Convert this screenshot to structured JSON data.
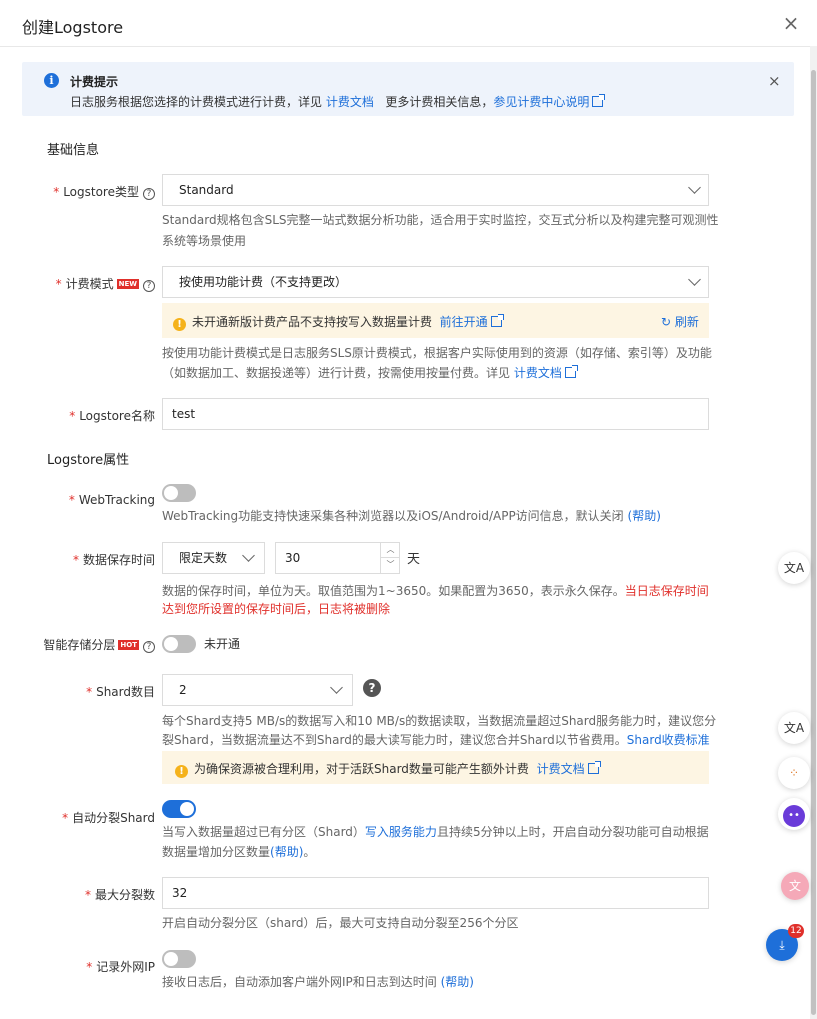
{
  "dialog": {
    "title": "创建Logstore",
    "close_icon": "×"
  },
  "notice": {
    "title": "计费提示",
    "text_prefix": "日志服务根据您选择的计费模式进行计费，详见",
    "link1": "计费文档",
    "text_mid": "更多计费相关信息，",
    "link2": "参见计费中心说明",
    "close_icon": "×"
  },
  "basic": {
    "section": "基础信息",
    "logstore_type": {
      "label": "Logstore类型",
      "value": "Standard",
      "help1": "Standard规格包含SLS完整一站式数据分析功能，适合用于实时监控，交互式分析以及构建完整可观测性",
      "help2": "系统等场景使用"
    },
    "billing_mode": {
      "label": "计费模式",
      "badge": "NEW",
      "value": "按使用功能计费（不支持更改）",
      "warn_text": "未开通新版计费产品不支持按写入数据量计费",
      "warn_link": "前往开通",
      "refresh": "刷新",
      "help1": "按使用功能计费模式是日志服务SLS原计费模式，根据客户实际使用到的资源（如存储、索引等）及功能",
      "help2": "（如数据加工、数据投递等）进行计费，按需使用按量付费。详见",
      "help_link": "计费文档"
    },
    "name": {
      "label": "Logstore名称",
      "value": "test"
    }
  },
  "attrs": {
    "section": "Logstore属性",
    "webtracking": {
      "label": "WebTracking",
      "enabled": false,
      "help": "WebTracking功能支持快速采集各种浏览器以及iOS/Android/APP访问信息，默认关闭",
      "help_link": "(帮助)"
    },
    "retention": {
      "label": "数据保存时间",
      "mode": "限定天数",
      "value": "30",
      "unit": "天",
      "help1": "数据的保存时间，单位为天。取值范围为1~3650。如果配置为3650，表示永久保存。",
      "help1_red": "当日志保存时间",
      "help2_red": "达到您所设置的保存时间后，日志将被删除"
    },
    "tiered": {
      "label": "智能存储分层",
      "badge": "HOT",
      "enabled": false,
      "status": "未开通"
    },
    "shard": {
      "label": "Shard数目",
      "value": "2",
      "help1": "每个Shard支持5 MB/s的数据写入和10 MB/s的数据读取，当数据流量超过Shard服务能力时，建议您分",
      "help2": "裂Shard，当数据流量达不到Shard的最大读写能力时，建议您合并Shard以节省费用。",
      "help_link": "Shard收费标准",
      "warn_text": "为确保资源被合理利用，对于活跃Shard数量可能产生额外计费",
      "warn_link": "计费文档"
    },
    "auto_split": {
      "label": "自动分裂Shard",
      "enabled": true,
      "help1a": "当写入数据量超过已有分区（Shard）",
      "help1_link": "写入服务能力",
      "help1b": "且持续5分钟以上时，开启自动分裂功能可自动根据",
      "help2": "数据量增加分区数量",
      "help2_link": "(帮助)",
      "help2_end": "。"
    },
    "max_split": {
      "label": "最大分裂数",
      "value": "32",
      "help": "开启自动分裂分区（shard）后，最大可支持自动分裂至256个分区"
    },
    "record_ip": {
      "label": "记录外网IP",
      "enabled": false,
      "help": "接收日志后，自动添加客户端外网IP和日志到达时间",
      "help_link": "(帮助)"
    }
  },
  "floating": {
    "translate": "文A",
    "notif_count": "12"
  }
}
